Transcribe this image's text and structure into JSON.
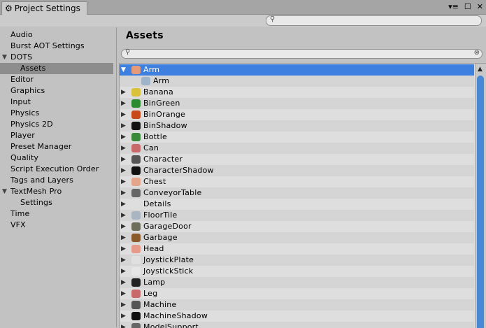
{
  "window": {
    "tab_title": "Project Settings",
    "controls": [
      "▾≡",
      "☐",
      "✕"
    ]
  },
  "sidebar": {
    "items": [
      {
        "label": "Audio",
        "level": 0,
        "arrow": ""
      },
      {
        "label": "Burst AOT Settings",
        "level": 0,
        "arrow": ""
      },
      {
        "label": "DOTS",
        "level": 0,
        "arrow": "▼"
      },
      {
        "label": "Assets",
        "level": 1,
        "arrow": "",
        "selected": true
      },
      {
        "label": "Editor",
        "level": 0,
        "arrow": ""
      },
      {
        "label": "Graphics",
        "level": 0,
        "arrow": ""
      },
      {
        "label": "Input",
        "level": 0,
        "arrow": ""
      },
      {
        "label": "Physics",
        "level": 0,
        "arrow": ""
      },
      {
        "label": "Physics 2D",
        "level": 0,
        "arrow": ""
      },
      {
        "label": "Player",
        "level": 0,
        "arrow": ""
      },
      {
        "label": "Preset Manager",
        "level": 0,
        "arrow": ""
      },
      {
        "label": "Quality",
        "level": 0,
        "arrow": ""
      },
      {
        "label": "Script Execution Order",
        "level": 0,
        "arrow": ""
      },
      {
        "label": "Tags and Layers",
        "level": 0,
        "arrow": ""
      },
      {
        "label": "TextMesh Pro",
        "level": 0,
        "arrow": "▼"
      },
      {
        "label": "Settings",
        "level": 1,
        "arrow": ""
      },
      {
        "label": "Time",
        "level": 0,
        "arrow": ""
      },
      {
        "label": "VFX",
        "level": 0,
        "arrow": ""
      }
    ]
  },
  "main": {
    "heading": "Assets",
    "search_placeholder": "",
    "assets": [
      {
        "name": "Arm",
        "arrow": "▼",
        "icon": "arm-icon",
        "selected": true,
        "level": 0,
        "color": "#e59a7a"
      },
      {
        "name": "Arm",
        "arrow": "",
        "icon": "prefab-icon",
        "level": 1,
        "color": "#9fb3c9"
      },
      {
        "name": "Banana",
        "arrow": "▶",
        "icon": "banana-icon",
        "level": 0,
        "color": "#d9c23a"
      },
      {
        "name": "BinGreen",
        "arrow": "▶",
        "icon": "bin-green-icon",
        "level": 0,
        "color": "#2e8a2e"
      },
      {
        "name": "BinOrange",
        "arrow": "▶",
        "icon": "bin-orange-icon",
        "level": 0,
        "color": "#c84a1a"
      },
      {
        "name": "BinShadow",
        "arrow": "▶",
        "icon": "bin-shadow-icon",
        "level": 0,
        "color": "#111111"
      },
      {
        "name": "Bottle",
        "arrow": "▶",
        "icon": "bottle-icon",
        "level": 0,
        "color": "#3a8a3a"
      },
      {
        "name": "Can",
        "arrow": "▶",
        "icon": "can-icon",
        "level": 0,
        "color": "#c96a6a"
      },
      {
        "name": "Character",
        "arrow": "▶",
        "icon": "character-icon",
        "level": 0,
        "color": "#555555"
      },
      {
        "name": "CharacterShadow",
        "arrow": "▶",
        "icon": "character-shadow-icon",
        "level": 0,
        "color": "#111111"
      },
      {
        "name": "Chest",
        "arrow": "▶",
        "icon": "chest-icon",
        "level": 0,
        "color": "#e5a58a"
      },
      {
        "name": "ConveyorTable",
        "arrow": "▶",
        "icon": "conveyor-icon",
        "level": 0,
        "color": "#666666"
      },
      {
        "name": "Details",
        "arrow": "▶",
        "icon": "details-icon",
        "level": 0,
        "color": "#dedede"
      },
      {
        "name": "FloorTile",
        "arrow": "▶",
        "icon": "floor-tile-icon",
        "level": 0,
        "color": "#a9b6c2"
      },
      {
        "name": "GarageDoor",
        "arrow": "▶",
        "icon": "garage-door-icon",
        "level": 0,
        "color": "#6e6e5a"
      },
      {
        "name": "Garbage",
        "arrow": "▶",
        "icon": "garbage-icon",
        "level": 0,
        "color": "#8a5a2a"
      },
      {
        "name": "Head",
        "arrow": "▶",
        "icon": "head-icon",
        "level": 0,
        "color": "#e59a8a"
      },
      {
        "name": "JoystickPlate",
        "arrow": "▶",
        "icon": "joystick-plate-icon",
        "level": 0,
        "color": "#e0e0e0"
      },
      {
        "name": "JoystickStick",
        "arrow": "▶",
        "icon": "joystick-stick-icon",
        "level": 0,
        "color": "#e6e6e6"
      },
      {
        "name": "Lamp",
        "arrow": "▶",
        "icon": "lamp-icon",
        "level": 0,
        "color": "#222222"
      },
      {
        "name": "Leg",
        "arrow": "▶",
        "icon": "leg-icon",
        "level": 0,
        "color": "#c96a6a"
      },
      {
        "name": "Machine",
        "arrow": "▶",
        "icon": "machine-icon",
        "level": 0,
        "color": "#555555"
      },
      {
        "name": "MachineShadow",
        "arrow": "▶",
        "icon": "machine-shadow-icon",
        "level": 0,
        "color": "#111111"
      },
      {
        "name": "ModelSupport",
        "arrow": "▶",
        "icon": "model-support-icon",
        "level": 0,
        "color": "#666666"
      }
    ]
  },
  "colors": {
    "selection": "#3d80df",
    "sidebar_selection": "#8d8d8d",
    "scrollbar_thumb": "#4a87d6"
  }
}
